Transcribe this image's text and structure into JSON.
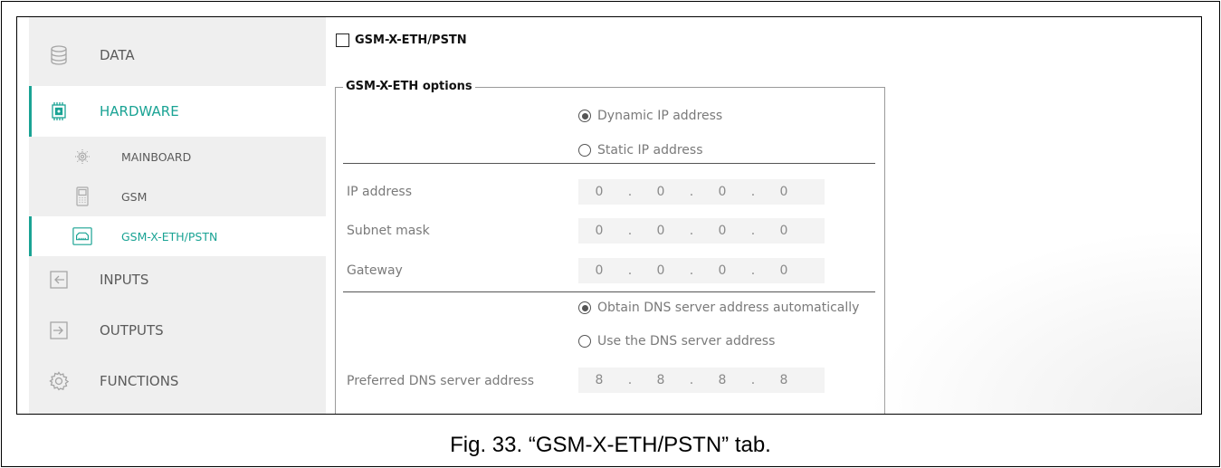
{
  "sidebar": {
    "items": [
      {
        "label": "DATA",
        "icon": "database-icon",
        "level": "main",
        "active": false
      },
      {
        "label": "HARDWARE",
        "icon": "chip-icon",
        "level": "main",
        "active": true
      },
      {
        "label": "MAINBOARD",
        "icon": "cog-board-icon",
        "level": "sub",
        "active": false
      },
      {
        "label": "GSM",
        "icon": "phone-icon",
        "level": "sub",
        "active": false
      },
      {
        "label": "GSM-X-ETH/PSTN",
        "icon": "ethernet-module-icon",
        "level": "sub",
        "active": true
      },
      {
        "label": "INPUTS",
        "icon": "input-arrow-icon",
        "level": "main",
        "active": false
      },
      {
        "label": "OUTPUTS",
        "icon": "output-arrow-icon",
        "level": "main",
        "active": false
      },
      {
        "label": "FUNCTIONS",
        "icon": "gear-icon",
        "level": "main",
        "active": false
      }
    ]
  },
  "module": {
    "checkbox_label": "GSM-X-ETH/PSTN",
    "checked": false
  },
  "group": {
    "title": "GSM-X-ETH options"
  },
  "ip_mode": {
    "dynamic_label": "Dynamic IP address",
    "static_label": "Static IP address",
    "selected": "dynamic"
  },
  "fields": {
    "ip_address": {
      "label": "IP address",
      "octets": [
        "0",
        "0",
        "0",
        "0"
      ]
    },
    "subnet_mask": {
      "label": "Subnet mask",
      "octets": [
        "0",
        "0",
        "0",
        "0"
      ]
    },
    "gateway": {
      "label": "Gateway",
      "octets": [
        "0",
        "0",
        "0",
        "0"
      ]
    },
    "preferred_dns": {
      "label": "Preferred DNS server address",
      "octets": [
        "8",
        "8",
        "8",
        "8"
      ]
    }
  },
  "dns_mode": {
    "auto_label": "Obtain DNS server address automatically",
    "manual_label": "Use the DNS server address",
    "selected": "auto"
  },
  "caption": "Fig. 33. “GSM-X-ETH/PSTN” tab.",
  "colors": {
    "accent": "#1aa394",
    "sidebar_bg": "#efefef",
    "disabled_text": "#7a7a7a"
  }
}
